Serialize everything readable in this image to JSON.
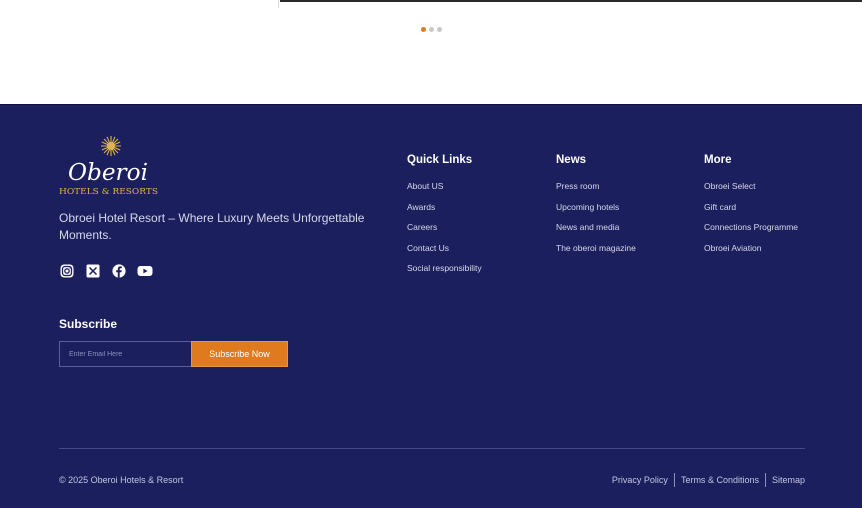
{
  "carousel": {
    "slide_count": 3,
    "active_index": 0,
    "active_color": "#e07a1f",
    "inactive_color": "#c8c8c8"
  },
  "brand": {
    "logo_script": "Oberoi",
    "logo_subtitle": "HOTELS & RESORTS",
    "logo_color": "#e0b548",
    "tagline": "Obroei Hotel Resort – Where Luxury Meets Unforgettable Moments."
  },
  "socials": [
    "instagram-icon",
    "x-icon",
    "facebook-icon",
    "youtube-icon"
  ],
  "subscribe": {
    "title": "Subscribe",
    "placeholder": "Enter Email Here",
    "button_label": "Subscribe Now"
  },
  "quick_links": {
    "title": "Quick Links",
    "items": [
      "About US",
      "Awards",
      "Careers",
      "Contact Us",
      "Social responsibility"
    ]
  },
  "news": {
    "title": "News",
    "items": [
      "Press room",
      "Upcoming hotels",
      "News and media",
      "The oberoi magazine"
    ]
  },
  "more": {
    "title": "More",
    "items": [
      "Obroei Select",
      "Gift card",
      "Connections Programme",
      "Obroei Aviation"
    ]
  },
  "bottom": {
    "copyright": "© 2025 Oberoi Hotels & Resort",
    "privacy": "Privacy Policy",
    "terms": "Terms & Conditions",
    "sitemap": "Sitemap"
  },
  "colors": {
    "footer_bg": "#1b1f5e",
    "accent": "#e07a1f"
  }
}
